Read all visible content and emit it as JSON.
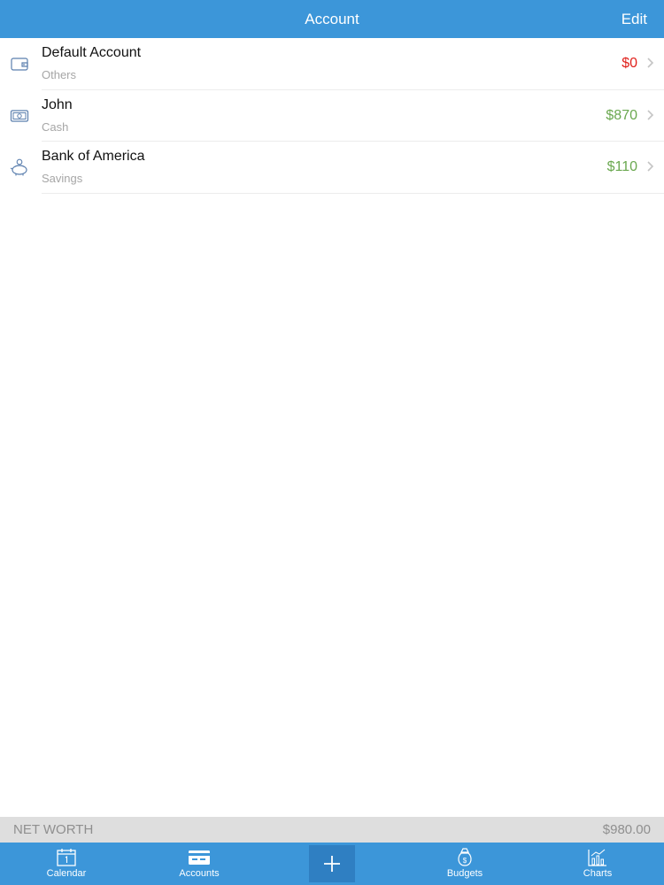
{
  "header": {
    "title": "Account",
    "edit_label": "Edit"
  },
  "accounts": [
    {
      "name": "Default Account",
      "type": "Others",
      "balance": "$0",
      "balance_color": "#e0201b",
      "icon": "wallet-icon"
    },
    {
      "name": "John",
      "type": "Cash",
      "balance": "$870",
      "balance_color": "#6aa84f",
      "icon": "cash-icon"
    },
    {
      "name": "Bank of America",
      "type": "Savings",
      "balance": "$110",
      "balance_color": "#6aa84f",
      "icon": "piggy-bank-icon"
    }
  ],
  "net_worth": {
    "label": "NET WORTH",
    "value": "$980.00"
  },
  "tabbar": {
    "tabs": [
      {
        "label": "Calendar",
        "icon": "calendar-icon"
      },
      {
        "label": "Accounts",
        "icon": "card-icon"
      },
      {
        "label": "Budgets",
        "icon": "money-bag-icon"
      },
      {
        "label": "Charts",
        "icon": "chart-icon"
      }
    ],
    "add_icon": "plus-icon"
  },
  "colors": {
    "accent": "#3c96d9",
    "accent_dark": "#2f7fc2",
    "negative": "#e0201b",
    "positive": "#6aa84f",
    "net_worth_bg": "#dedede"
  }
}
